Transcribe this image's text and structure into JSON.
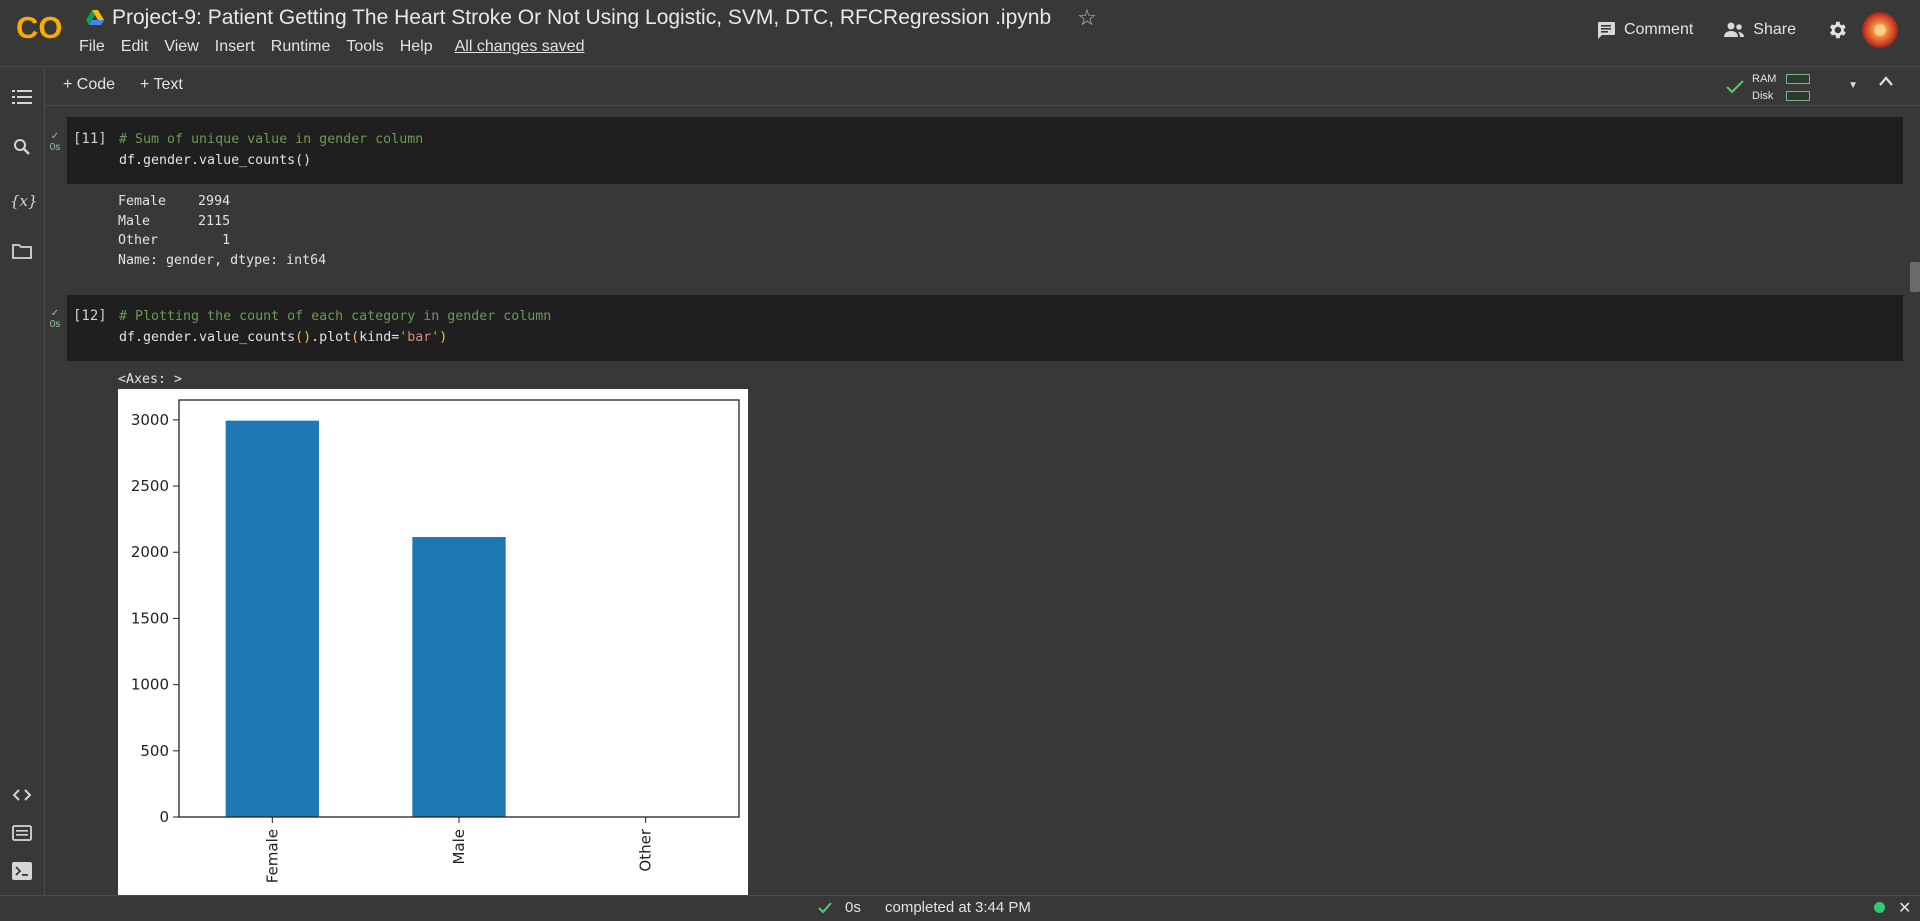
{
  "header": {
    "logo_text": "CO",
    "title": "Project-9: Patient Getting The Heart Stroke Or Not Using Logistic,  SVM, DTC, RFCRegression .ipynb",
    "menu": [
      "File",
      "Edit",
      "View",
      "Insert",
      "Runtime",
      "Tools",
      "Help"
    ],
    "saved_status": "All changes saved",
    "comment_label": "Comment",
    "share_label": "Share",
    "colors": {
      "brand_orange": "#F9AB00",
      "brand_dark_orange": "#E37400"
    }
  },
  "rail": {
    "icons": [
      "toc-icon",
      "search-icon",
      "variables-icon",
      "folder-icon",
      "code-snippets-icon",
      "command-palette-icon",
      "terminal-icon"
    ],
    "variables_glyph": "{x}"
  },
  "toolbar": {
    "add_code_label": "+ Code",
    "add_text_label": "+ Text",
    "ram_label": "RAM",
    "disk_label": "Disk"
  },
  "cells": [
    {
      "number": "[11]",
      "exec_time": "0s",
      "comment": "# Sum of unique value in gender column",
      "code_line": "df.gender.value_counts()",
      "output_lines": [
        "Female    2994",
        "Male      2115",
        "Other        1",
        "Name: gender, dtype: int64"
      ]
    },
    {
      "number": "[12]",
      "exec_time": "0s",
      "comment": "# Plotting the count of each category in gender column",
      "code_prefix": "df.gender.value_counts",
      "code_mid": ".plot",
      "code_kwarg": "kind=",
      "code_str": "'bar'",
      "output_text": "<Axes: >"
    }
  ],
  "chart_data": {
    "type": "bar",
    "categories": [
      "Female",
      "Male",
      "Other"
    ],
    "values": [
      2994,
      2115,
      1
    ],
    "ylim": [
      0,
      3150
    ],
    "yticks": [
      0,
      500,
      1000,
      1500,
      2000,
      2500,
      3000
    ],
    "bar_color": "#1f77b4",
    "xlabel": "",
    "ylabel": "",
    "grid": false
  },
  "statusbar": {
    "exec_time": "0s",
    "completed_text": "completed at 3:44 PM"
  }
}
